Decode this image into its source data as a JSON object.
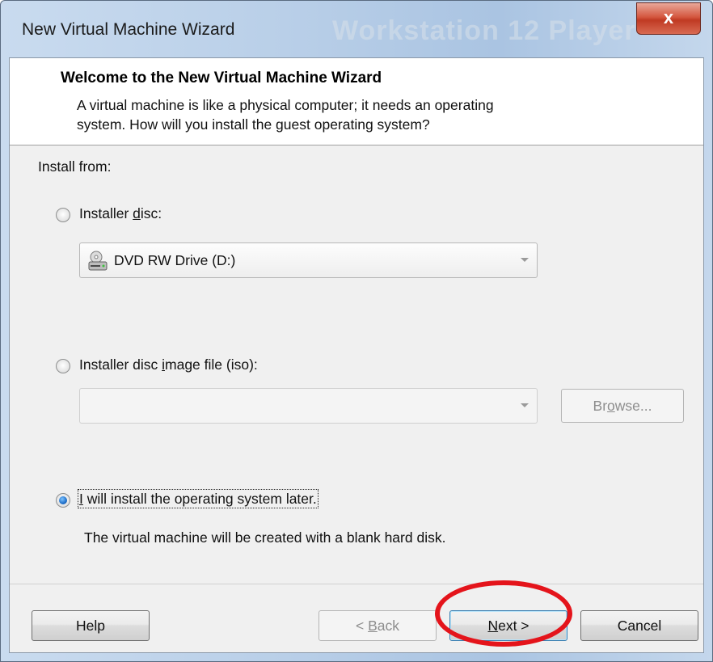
{
  "window": {
    "title": "New Virtual Machine Wizard",
    "background_watermark": "Workstation 12 Player",
    "close_glyph": "x"
  },
  "header": {
    "title": "Welcome to the New Virtual Machine Wizard",
    "description_line1": "A virtual machine is like a physical computer; it needs an operating",
    "description_line2": "system. How will you install the guest operating system?"
  },
  "install": {
    "group_label": "Install from:",
    "options": [
      {
        "pre": "Installer ",
        "mnemonic": "d",
        "post": "isc:",
        "selected": false
      },
      {
        "pre": "Installer disc ",
        "mnemonic": "i",
        "post": "mage file (iso):",
        "selected": false
      },
      {
        "pre": "",
        "mnemonic": "I",
        "post": " will install the operating system later.",
        "selected": true
      }
    ],
    "disc_combo": {
      "value": "DVD RW Drive (D:)",
      "icon": "dvd-drive-icon"
    },
    "iso_combo": {
      "value": ""
    },
    "browse": {
      "pre": "Br",
      "mnemonic": "o",
      "post": "wse..."
    },
    "later_note": "The virtual machine will be created with a blank hard disk."
  },
  "footer": {
    "help": "Help",
    "back": {
      "pre": "< ",
      "mnemonic": "B",
      "post": "ack"
    },
    "next": {
      "pre": "",
      "mnemonic": "N",
      "post": "ext >"
    },
    "cancel": "Cancel"
  },
  "annotation_color": "#e4141b"
}
